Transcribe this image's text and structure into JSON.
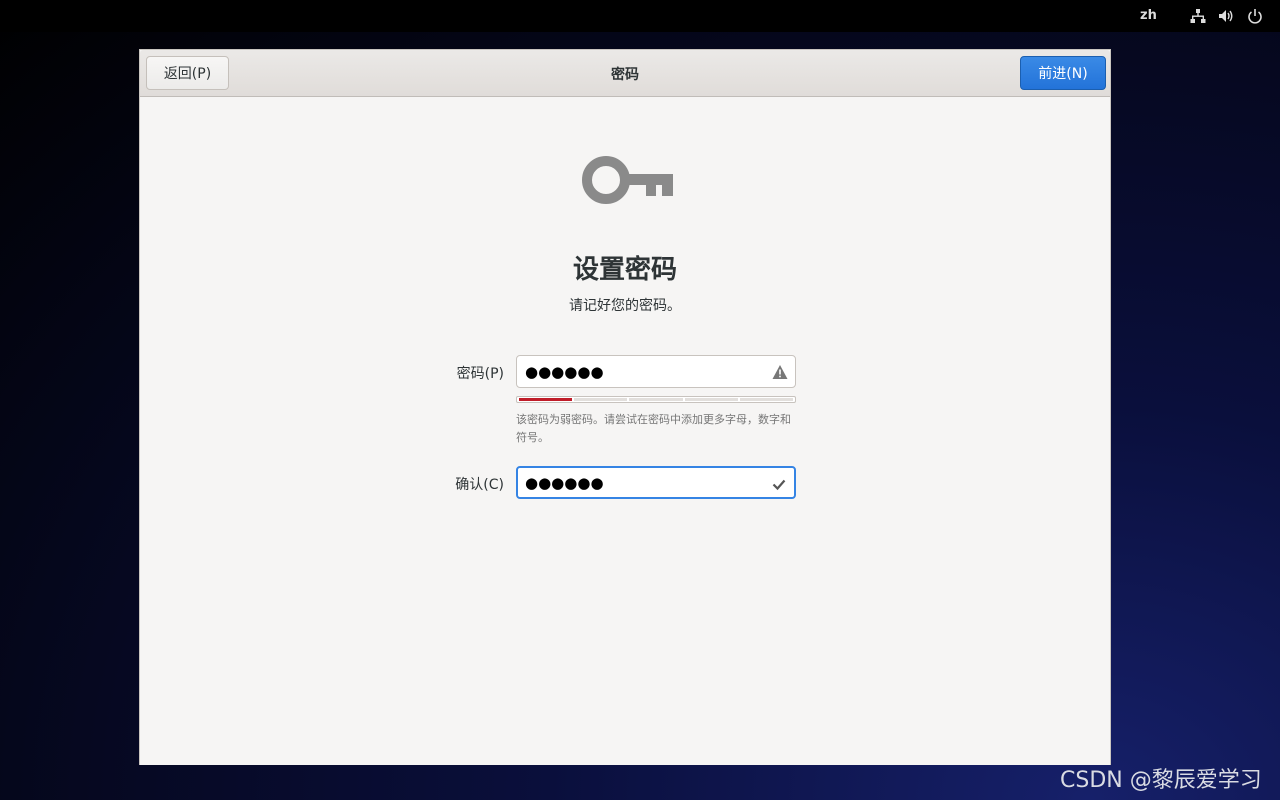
{
  "topbar": {
    "language": "zh",
    "icons": [
      "network-icon",
      "volume-icon",
      "power-icon"
    ]
  },
  "window": {
    "title": "密码",
    "back_label": "返回(P)",
    "next_label": "前进(N)",
    "accent_color": "#2373d9"
  },
  "page": {
    "heading": "设置密码",
    "subtitle": "请记好您的密码。",
    "icon": "key-icon"
  },
  "form": {
    "password_label": "密码(P)",
    "password_value": "●●●●●●",
    "password_status_icon": "warning-icon",
    "strength_level": 0.2,
    "strength_color": "#c01c28",
    "strength_hint": "该密码为弱密码。请尝试在密码中添加更多字母，数字和符号。",
    "confirm_label": "确认(C)",
    "confirm_value": "●●●●●●",
    "confirm_status_icon": "checkmark-icon"
  },
  "watermark": "CSDN @黎辰爱学习"
}
